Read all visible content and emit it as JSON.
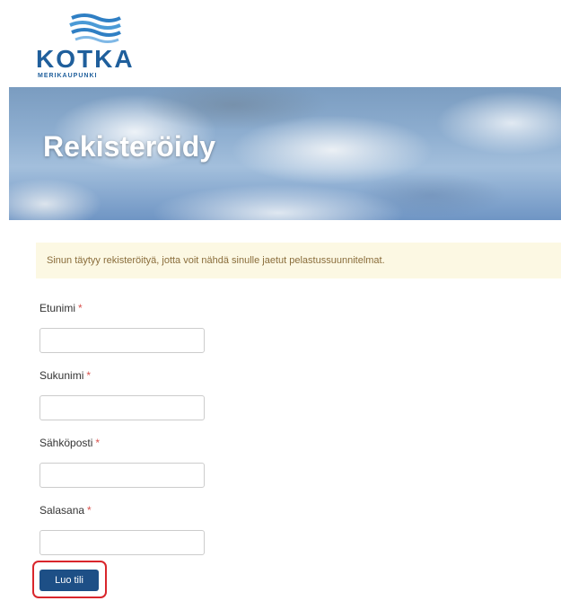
{
  "logo": {
    "name": "KOTKA",
    "subtitle": "MERIKAUPUNKI",
    "brand_color": "#1f5f9c"
  },
  "hero": {
    "title": "Rekisteröidy"
  },
  "notice": {
    "text": "Sinun täytyy rekisteröityä, jotta voit nähdä sinulle jaetut pelastussuunnitelmat.",
    "bg_color": "#fcf8e3"
  },
  "form": {
    "first_name": {
      "label": "Etunimi",
      "required_mark": "*",
      "value": ""
    },
    "last_name": {
      "label": "Sukunimi",
      "required_mark": "*",
      "value": ""
    },
    "email": {
      "label": "Sähköposti",
      "required_mark": "*",
      "value": ""
    },
    "password": {
      "label": "Salasana",
      "required_mark": "*",
      "value": ""
    },
    "submit_label": "Luo tili",
    "submit_color": "#1d4f86",
    "highlight_color": "#d9262c"
  }
}
